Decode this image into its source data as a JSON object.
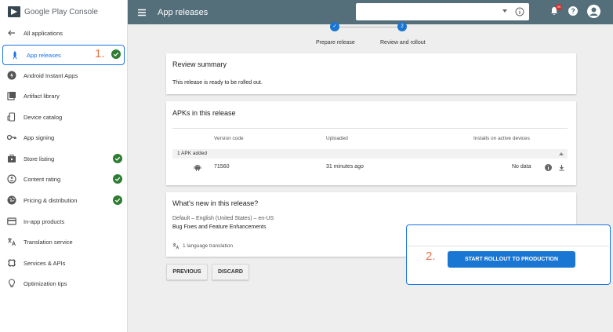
{
  "brand": {
    "name": "Google Play",
    "suffix": "Console"
  },
  "sidebar": {
    "back_label": "All applications",
    "items": [
      {
        "label": "App releases",
        "icon": "rocket-icon",
        "active": true,
        "checked": true
      },
      {
        "label": "Android Instant Apps",
        "icon": "bolt-icon",
        "checked": false
      },
      {
        "label": "Artifact library",
        "icon": "library-icon",
        "checked": false
      },
      {
        "label": "Device catalog",
        "icon": "device-icon",
        "checked": false
      },
      {
        "label": "App signing",
        "icon": "key-icon",
        "checked": false
      },
      {
        "label": "Store listing",
        "icon": "store-icon",
        "checked": true
      },
      {
        "label": "Content rating",
        "icon": "rating-icon",
        "checked": true
      },
      {
        "label": "Pricing & distribution",
        "icon": "globe-icon",
        "checked": true
      },
      {
        "label": "In-app products",
        "icon": "card-icon",
        "checked": false
      },
      {
        "label": "Translation service",
        "icon": "translate-icon",
        "checked": false
      },
      {
        "label": "Services & APIs",
        "icon": "services-icon",
        "checked": false
      },
      {
        "label": "Optimization tips",
        "icon": "lightbulb-icon",
        "checked": false
      }
    ]
  },
  "annotations": {
    "step1": "1.",
    "step2": "2."
  },
  "topbar": {
    "title": "App releases",
    "search_value": "",
    "notification_count": "99"
  },
  "stepper": {
    "steps": [
      {
        "label": "Prepare release",
        "marker": "✓"
      },
      {
        "label": "Review and rollout",
        "marker": "2"
      }
    ]
  },
  "review": {
    "title": "Review summary",
    "text": "This release is ready to be rolled out."
  },
  "apks": {
    "title": "APKs in this release",
    "columns": [
      "Version code",
      "Uploaded",
      "Installs on active devices"
    ],
    "group_label": "1 APK added",
    "rows": [
      {
        "version_code": "71560",
        "uploaded": "31 minutes ago",
        "installs": "No data"
      }
    ]
  },
  "whats_new": {
    "title": "What's new in this release?",
    "locale": "Default – English (United States) – en-US",
    "notes": "Bug Fixes and Feature Enhancements",
    "translation": "1 language translation"
  },
  "buttons": {
    "previous": "PREVIOUS",
    "discard": "DISCARD",
    "rollout": "START ROLLOUT TO PRODUCTION"
  },
  "colors": {
    "topbar": "#546e7a",
    "accent": "#1976d2",
    "check": "#2e7d32",
    "annotation": "#e8734a"
  }
}
